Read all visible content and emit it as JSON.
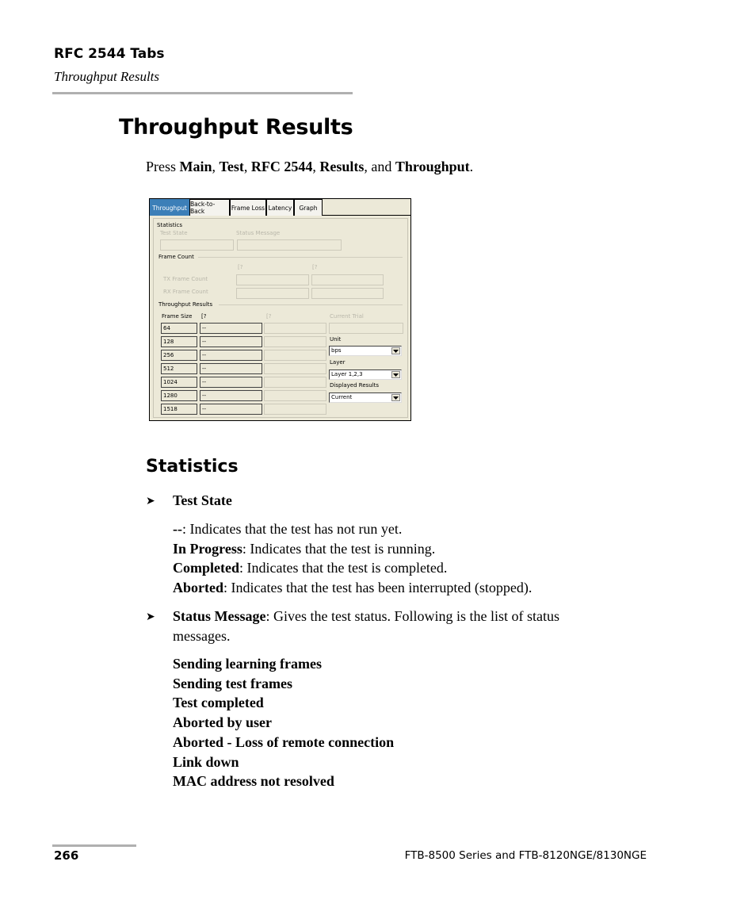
{
  "header": {
    "chapter": "RFC 2544 Tabs",
    "section": "Throughput Results"
  },
  "page_title": "Throughput Results",
  "instruction": {
    "prefix": "Press ",
    "steps": [
      "Main",
      "Test",
      "RFC 2544",
      "Results",
      "Throughput"
    ],
    "sep": ", ",
    "and": ", and ",
    "suffix": "."
  },
  "ui": {
    "tabs": [
      {
        "label": "Throughput",
        "active": true
      },
      {
        "label": "Back-to-Back",
        "active": false
      },
      {
        "label": "Frame Loss",
        "active": false
      },
      {
        "label": "Latency",
        "active": false
      },
      {
        "label": "Graph",
        "active": false
      }
    ],
    "statistics": {
      "group_label": "Statistics",
      "test_state_label": "Test State",
      "status_message_label": "Status Message",
      "test_state_value": "",
      "status_message_value": ""
    },
    "frame_count": {
      "group_label": "Frame Count",
      "col1_header": "[?",
      "col2_header": "[?",
      "rows": [
        {
          "label": "TX Frame Count",
          "v1": "",
          "v2": ""
        },
        {
          "label": "RX Frame Count",
          "v1": "",
          "v2": ""
        }
      ]
    },
    "throughput_results": {
      "group_label": "Throughput Results",
      "frame_size_header": "Frame Size",
      "col1_header": "[?",
      "col2_header": "[?",
      "current_trial_label": "Current Trial",
      "current_trial_value": "",
      "rows": [
        {
          "frame_size": "64",
          "v1": "--",
          "v2": ""
        },
        {
          "frame_size": "128",
          "v1": "--",
          "v2": ""
        },
        {
          "frame_size": "256",
          "v1": "--",
          "v2": ""
        },
        {
          "frame_size": "512",
          "v1": "--",
          "v2": ""
        },
        {
          "frame_size": "1024",
          "v1": "--",
          "v2": ""
        },
        {
          "frame_size": "1280",
          "v1": "--",
          "v2": ""
        },
        {
          "frame_size": "1518",
          "v1": "--",
          "v2": ""
        }
      ],
      "unit": {
        "label": "Unit",
        "value": "bps"
      },
      "layer": {
        "label": "Layer",
        "value": "Layer 1,2,3"
      },
      "displayed_results": {
        "label": "Displayed Results",
        "value": "Current"
      }
    }
  },
  "statistics_section": {
    "title": "Statistics",
    "bullet_icon": "arrow-bullet-icon",
    "test_state": {
      "term": "Test State",
      "definitions": [
        {
          "term": "--",
          "text": ": Indicates that the test has not run yet."
        },
        {
          "term": "In Progress",
          "text": ": Indicates that the test is running."
        },
        {
          "term": "Completed",
          "text": ": Indicates that the test is completed."
        },
        {
          "term": "Aborted",
          "text": ": Indicates that the test has been interrupted (stopped)."
        }
      ]
    },
    "status_message": {
      "term": "Status Message",
      "text_line1": ": Gives the test status. Following is the list of status",
      "text_line2": "messages.",
      "messages": [
        "Sending learning frames",
        "Sending test frames",
        "Test completed",
        "Aborted by user",
        "Aborted - Loss of remote connection",
        "Link down",
        "MAC address not resolved"
      ]
    }
  },
  "footer": {
    "page_number": "266",
    "product": "FTB-8500 Series and FTB-8120NGE/8130NGE"
  }
}
